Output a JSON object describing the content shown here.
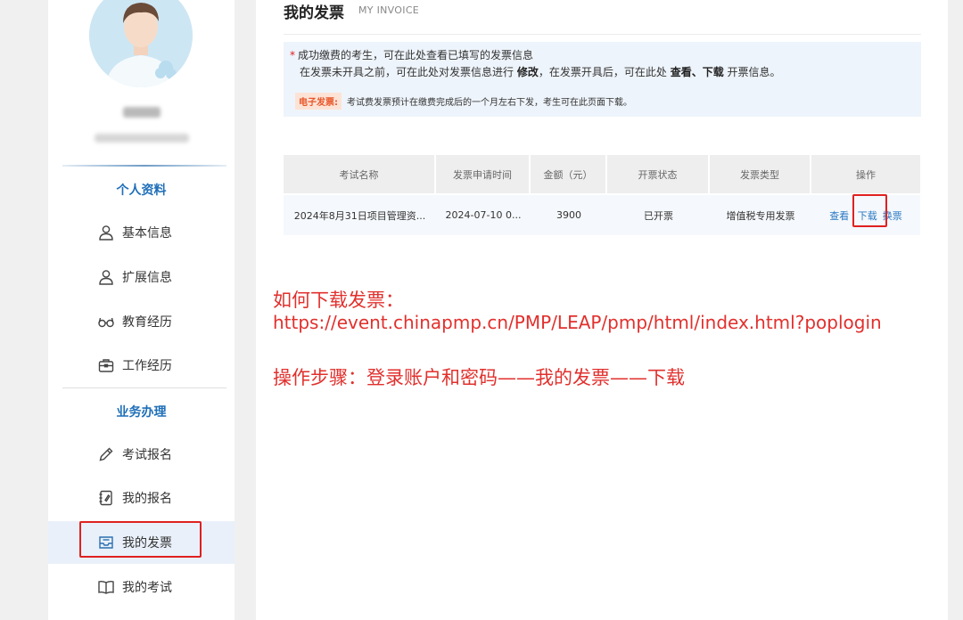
{
  "sidebar": {
    "sections": [
      {
        "title": "个人资料"
      },
      {
        "title": "业务办理"
      }
    ],
    "items": [
      {
        "label": "基本信息",
        "icon": "user-icon"
      },
      {
        "label": "扩展信息",
        "icon": "user-icon"
      },
      {
        "label": "教育经历",
        "icon": "glasses-icon"
      },
      {
        "label": "工作经历",
        "icon": "briefcase-icon"
      },
      {
        "label": "考试报名",
        "icon": "pencil-icon"
      },
      {
        "label": "我的报名",
        "icon": "notebook-icon"
      },
      {
        "label": "我的发票",
        "icon": "inbox-icon",
        "active": true
      },
      {
        "label": "我的考试",
        "icon": "book-icon"
      }
    ]
  },
  "page": {
    "title": "我的发票",
    "subtitle": "MY INVOICE"
  },
  "notice": {
    "star": "*",
    "line1": "成功缴费的考生，可在此处查看已填写的发票信息",
    "line2_a": "在发票未开具之前，可在此处对发票信息进行",
    "line2_modify": "修改",
    "line2_b": "，在发票开具后，可在此处",
    "line2_view": "查看、下载",
    "line2_c": "开票信息。",
    "tag": "电子发票:",
    "line3": "考试费发票预计在缴费完成后的一个月左右下发，考生可在此页面下载。"
  },
  "table": {
    "headers": [
      "考试名称",
      "发票申请时间",
      "金额（元）",
      "开票状态",
      "发票类型",
      "操作"
    ],
    "rows": [
      {
        "name": "2024年8月31日项目管理资...",
        "time": "2024-07-10 0...",
        "amount": "3900",
        "status": "已开票",
        "type": "增值税专用发票",
        "actions": [
          "查看",
          "下载",
          "换票"
        ]
      }
    ]
  },
  "annotation": {
    "line1": "如何下载发票：",
    "line2": "https://event.chinapmp.cn/PMP/LEAP/pmp/html/index.html?poplogin",
    "line3": "操作步骤：登录账户和密码——我的发票——下载"
  },
  "colors": {
    "accent": "#1f6fb8",
    "highlight_box": "#e02020",
    "annotation_text": "#e1302d",
    "status_ok": "#2faa5c"
  }
}
